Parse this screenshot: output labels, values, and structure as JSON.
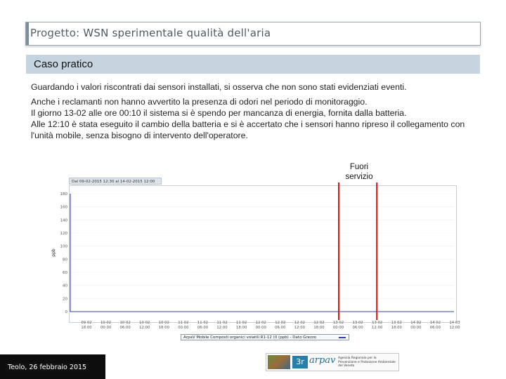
{
  "slide": {
    "title_prefix": "Progetto:",
    "title_main": "WSN sperimentale qualità dell'aria",
    "section_label": "Caso pratico",
    "paragraphs": [
      "Guardando i valori riscontrati dai sensori installati, si osserva che non sono stati evidenziati eventi.",
      "Anche i reclamanti non hanno avvertito la presenza di odori nel periodo di monitoraggio.",
      "Il giorno 13-02 alle ore 00:10 il sistema si è spendo per mancanza di energia, fornita dalla batteria.",
      "Alle 12:10 è stata eseguito il cambio della batteria e si è accertato che i sensori hanno ripreso il collegamento con l'unità mobile, senza bisogno di intervento dell'operatore."
    ],
    "annotation": {
      "line1": "Fuori",
      "line2": "servizio"
    },
    "footer_date": "Teolo, 26 febbraio 2015",
    "logo": {
      "mark": "3r",
      "name": "arpav",
      "agency": "Agenzia Regionale per la Prevenzione e Protezione Ambientale del Veneto"
    }
  },
  "chart_data": {
    "type": "line",
    "header": "Dal 09-02-2015 12:30 al 14-02-2015 12:00",
    "ylabel": "ppb",
    "ylim": [
      0,
      180
    ],
    "yticks": [
      "180",
      "160",
      "140",
      "120",
      "100",
      "80",
      "60",
      "40",
      "20",
      "0"
    ],
    "xticks": [
      [
        "09 02",
        "18:00"
      ],
      [
        "10 02",
        "00:00"
      ],
      [
        "10 02",
        "06:00"
      ],
      [
        "10 02",
        "12:00"
      ],
      [
        "10 02",
        "18:00"
      ],
      [
        "11 02",
        "00:00"
      ],
      [
        "11 02",
        "06:00"
      ],
      [
        "11 02",
        "12:00"
      ],
      [
        "11 02",
        "18:00"
      ],
      [
        "12 02",
        "00:00"
      ],
      [
        "12 02",
        "06:00"
      ],
      [
        "12 02",
        "12:00"
      ],
      [
        "12 02",
        "18:00"
      ],
      [
        "13 02",
        "00:00"
      ],
      [
        "13 02",
        "06:00"
      ],
      [
        "13 02",
        "12:00"
      ],
      [
        "13 02",
        "18:00"
      ],
      [
        "14 02",
        "00:00"
      ],
      [
        "14 02",
        "06:00"
      ],
      [
        "14 03",
        "12:00"
      ]
    ],
    "series": [
      {
        "name": "ArpaV Mobile Composti organici volatili R1-12 (0 (ppb) - Dato Grezzo",
        "values_description": "approximately 0 across the period, with an initial spike near 180 at the start"
      }
    ],
    "outage": {
      "start_tick_index": 13,
      "end_tick_index": 15
    },
    "colors": {
      "series": "#3340a8",
      "outage": "#d01818"
    }
  }
}
